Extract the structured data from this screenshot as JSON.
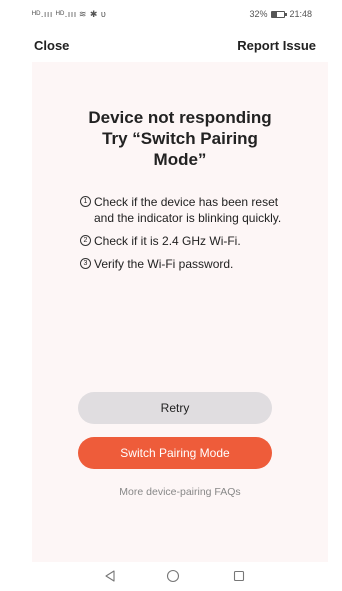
{
  "status_bar": {
    "signal_text": "ᴴᴰ.ııı ᴴᴰ.ııı",
    "extra_icons": "≋ ✱ υ",
    "battery_percent": "32%",
    "time": "21:48"
  },
  "top_bar": {
    "close_label": "Close",
    "report_label": "Report Issue"
  },
  "main": {
    "title_line1": "Device not responding",
    "title_line2": "Try “Switch Pairing",
    "title_line3": "Mode”",
    "tips": [
      {
        "number": "1",
        "text": "Check if the device has been reset and the indicator is blinking quickly."
      },
      {
        "number": "2",
        "text": "Check if it is 2.4 GHz Wi-Fi."
      },
      {
        "number": "3",
        "text": "Verify the Wi-Fi password."
      }
    ],
    "retry_label": "Retry",
    "switch_label": "Switch Pairing Mode",
    "faq_label": "More device-pairing FAQs"
  },
  "colors": {
    "accent": "#ee5c3a",
    "card_background": "#fdf6f6",
    "retry_background": "#e0dde0"
  },
  "nav_icons": [
    "back-triangle-icon",
    "home-circle-icon",
    "recent-square-icon"
  ]
}
